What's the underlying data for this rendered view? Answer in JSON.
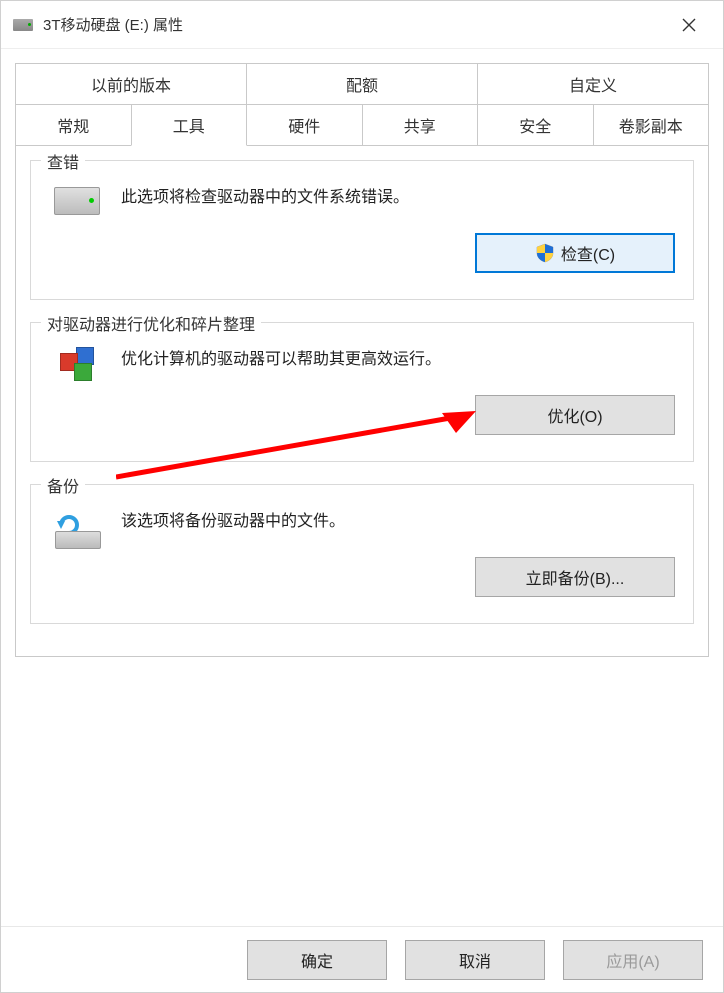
{
  "window": {
    "title": "3T移动硬盘 (E:) 属性"
  },
  "tabs": {
    "row1": [
      "以前的版本",
      "配额",
      "自定义"
    ],
    "row2": [
      "常规",
      "工具",
      "硬件",
      "共享",
      "安全",
      "卷影副本"
    ],
    "active": "工具"
  },
  "sections": {
    "check": {
      "title": "查错",
      "desc": "此选项将检查驱动器中的文件系统错误。",
      "button": "检查(C)"
    },
    "optimize": {
      "title": "对驱动器进行优化和碎片整理",
      "desc": "优化计算机的驱动器可以帮助其更高效运行。",
      "button": "优化(O)"
    },
    "backup": {
      "title": "备份",
      "desc": "该选项将备份驱动器中的文件。",
      "button": "立即备份(B)..."
    }
  },
  "footer": {
    "ok": "确定",
    "cancel": "取消",
    "apply": "应用(A)"
  }
}
